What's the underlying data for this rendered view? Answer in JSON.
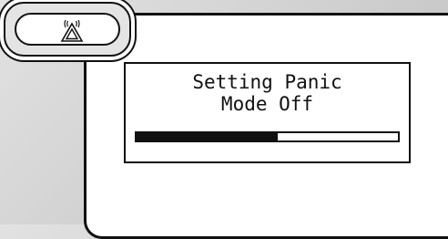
{
  "icons": {
    "panic": "panic-alarm-triangle-icon"
  },
  "screen": {
    "line1": "Setting Panic",
    "line2": "Mode Off"
  },
  "progress": {
    "fraction": 0.54
  },
  "colors": {
    "ink": "#111111",
    "background": "#d2d2d2",
    "screen": "#ffffff"
  }
}
